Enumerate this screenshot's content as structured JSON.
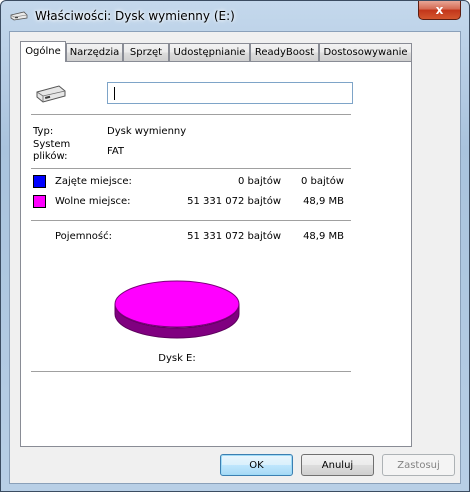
{
  "window": {
    "title": "Właściwości: Dysk wymienny (E:)",
    "close_symbol": "x"
  },
  "tabs": [
    {
      "label": "Ogólne",
      "active": true
    },
    {
      "label": "Narzędzia"
    },
    {
      "label": "Sprzęt"
    },
    {
      "label": "Udostępnianie"
    },
    {
      "label": "ReadyBoost"
    },
    {
      "label": "Dostosowywanie"
    }
  ],
  "general": {
    "drive_icon": "removable-drive-icon",
    "name_value": "",
    "type_label": "Typ:",
    "type_value": "Dysk wymienny",
    "fs_label_line1": "System",
    "fs_label_line2": "plików:",
    "fs_value": "FAT",
    "used": {
      "label": "Zajęte miejsce:",
      "bytes": "0 bajtów",
      "size": "0 bajtów",
      "color": "#0000ff"
    },
    "free": {
      "label": "Wolne miejsce:",
      "bytes": "51 331 072 bajtów",
      "size": "48,9 MB",
      "color": "#ff00ff"
    },
    "capacity": {
      "label": "Pojemność:",
      "bytes": "51 331 072 bajtów",
      "size": "48,9 MB"
    },
    "disk_caption": "Dysk E:",
    "used_fraction": 0
  },
  "buttons": {
    "ok": "OK",
    "cancel": "Anuluj",
    "apply": "Zastosuj"
  }
}
